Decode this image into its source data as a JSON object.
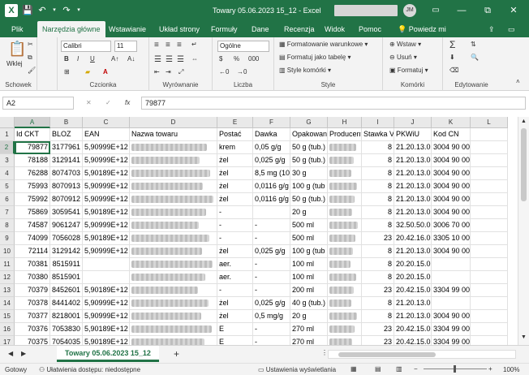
{
  "titlebar": {
    "title": "Towary 05.06.2023 15_12",
    "app": "Excel",
    "user_initials": "JM",
    "undo": "↶",
    "redo": "↷",
    "save": "💾",
    "min": "—",
    "max": "☐",
    "close": "✕",
    "restore": "⧉"
  },
  "menu": {
    "tabs": [
      "Plik",
      "Narzędzia główne",
      "Wstawianie",
      "Układ strony",
      "Formuły",
      "Dane",
      "Recenzja",
      "Widok",
      "Pomoc"
    ],
    "tell_me": "Powiedz mi"
  },
  "ribbon": {
    "clipboard": {
      "paste": "Wklej",
      "label": "Schowek"
    },
    "font": {
      "name": "Calibri",
      "size": "11",
      "bold": "B",
      "italic": "I",
      "underline": "U",
      "grow": "A↑",
      "shrink": "A↓",
      "label": "Czcionka"
    },
    "alignment": {
      "label": "Wyrównanie"
    },
    "number": {
      "format": "Ogólne",
      "currency": "$",
      "percent": "%",
      "comma": "000",
      "label": "Liczba"
    },
    "styles": {
      "conditional": "Formatowanie warunkowe",
      "table": "Formatuj jako tabelę",
      "cell": "Style komórki",
      "label": "Style"
    },
    "cells": {
      "insert": "Wstaw",
      "delete": "Usuń",
      "format": "Formatuj",
      "label": "Komórki"
    },
    "editing": {
      "label": "Edytowanie"
    }
  },
  "formula": {
    "namebox": "A2",
    "fx": "fx",
    "value": "79877",
    "cancel": "✕",
    "enter": "✓"
  },
  "grid": {
    "columns": [
      "A",
      "B",
      "C",
      "D",
      "E",
      "F",
      "G",
      "H",
      "I",
      "J",
      "K",
      "L"
    ],
    "rows": [
      [
        "Id CKT",
        "BLOZ",
        "EAN",
        "Nazwa towaru",
        "Postać",
        "Dawka",
        "Opakowanie",
        "Producent",
        "Stawka VAT",
        "PKWiU",
        "Kod CN",
        ""
      ],
      [
        "79877",
        "3177961",
        "5,90999E+12",
        "",
        "krem",
        "0,05 g/g",
        "50 g (tub.)",
        "",
        "8",
        "21.20.13.0",
        "3004 90 00",
        ""
      ],
      [
        "78188",
        "3129141",
        "5,90999E+12",
        "",
        "żel",
        "0,025 g/g",
        "50 g (tub.)",
        "",
        "8",
        "21.20.13.0",
        "3004 90 00",
        ""
      ],
      [
        "76288",
        "8074703",
        "5,90189E+12",
        "",
        "żel",
        "8,5 mg (10",
        "30 g",
        "",
        "8",
        "21.20.13.0",
        "3004 90 00",
        ""
      ],
      [
        "75993",
        "8070913",
        "5,90999E+12",
        "",
        "żel",
        "0,0116 g/g",
        "100 g (tub",
        "",
        "8",
        "21.20.13.0",
        "3004 90 00",
        ""
      ],
      [
        "75992",
        "8070912",
        "5,90999E+12",
        "",
        "żel",
        "0,0116 g/g",
        "50 g (tub.)",
        "",
        "8",
        "21.20.13.0",
        "3004 90 00",
        ""
      ],
      [
        "75869",
        "3059541",
        "5,90189E+12",
        "",
        "-",
        "",
        "20 g",
        "",
        "8",
        "21.20.13.0",
        "3004 90 00",
        ""
      ],
      [
        "74587",
        "9061247",
        "5,90999E+12",
        "",
        "-",
        "-",
        "500 ml",
        "",
        "8",
        "32.50.50.0",
        "3006 70 00",
        ""
      ],
      [
        "74099",
        "7056028",
        "5,90189E+12",
        "",
        "-",
        "-",
        "500 ml",
        "",
        "23",
        "20.42.16.0",
        "3305 10 00",
        ""
      ],
      [
        "72114",
        "3129142",
        "5,90999E+12",
        "",
        "żel",
        "0,025 g/g",
        "100 g (tub",
        "",
        "8",
        "21.20.13.0",
        "3004 90 00",
        ""
      ],
      [
        "70381",
        "8515911",
        "",
        "",
        "aer.",
        "-",
        "100 ml",
        "",
        "8",
        "20.20.15.0",
        "",
        ""
      ],
      [
        "70380",
        "8515901",
        "",
        "",
        "aer.",
        "-",
        "100 ml",
        "",
        "8",
        "20.20.15.0",
        "",
        ""
      ],
      [
        "70379",
        "8452601",
        "5,90189E+12",
        "",
        "-",
        "-",
        "200 ml",
        "",
        "23",
        "20.42.15.0",
        "3304 99 00",
        ""
      ],
      [
        "70378",
        "8441402",
        "5,90999E+12",
        "",
        "żel",
        "0,025 g/g",
        "40 g (tub.)",
        "",
        "8",
        "21.20.13.0",
        "",
        ""
      ],
      [
        "70377",
        "8218001",
        "5,90999E+12",
        "",
        "żel",
        "0,5 mg/g",
        "20 g",
        "",
        "8",
        "21.20.13.0",
        "3004 90 00",
        ""
      ],
      [
        "70376",
        "7053830",
        "5,90189E+12",
        "",
        "E",
        "-",
        "270 ml",
        "",
        "23",
        "20.42.15.0",
        "3304 99 00",
        ""
      ],
      [
        "70375",
        "7054035",
        "5,90189E+12",
        "",
        "E",
        "-",
        "270 ml",
        "",
        "23",
        "20.42.15.0",
        "3304 99 00",
        ""
      ],
      [
        "70374",
        "7054033",
        "5,90189E+12",
        "",
        "E",
        "-",
        "200 ml",
        "",
        "23",
        "20.42.15.0",
        "3304 99 00",
        ""
      ],
      [
        "70373",
        "7054032",
        "5,90189E+12",
        "",
        "E",
        "-",
        "200 ml",
        "",
        "23",
        "20.42.15.0",
        "3304 99 00",
        ""
      ]
    ]
  },
  "sheet": {
    "name": "Towary 05.06.2023 15_12",
    "add": "+"
  },
  "status": {
    "ready": "Gotowy",
    "accessibility": "Ułatwienia dostępu: niedostępne",
    "display": "Ustawienia wyświetlania",
    "zoom": "100%"
  }
}
